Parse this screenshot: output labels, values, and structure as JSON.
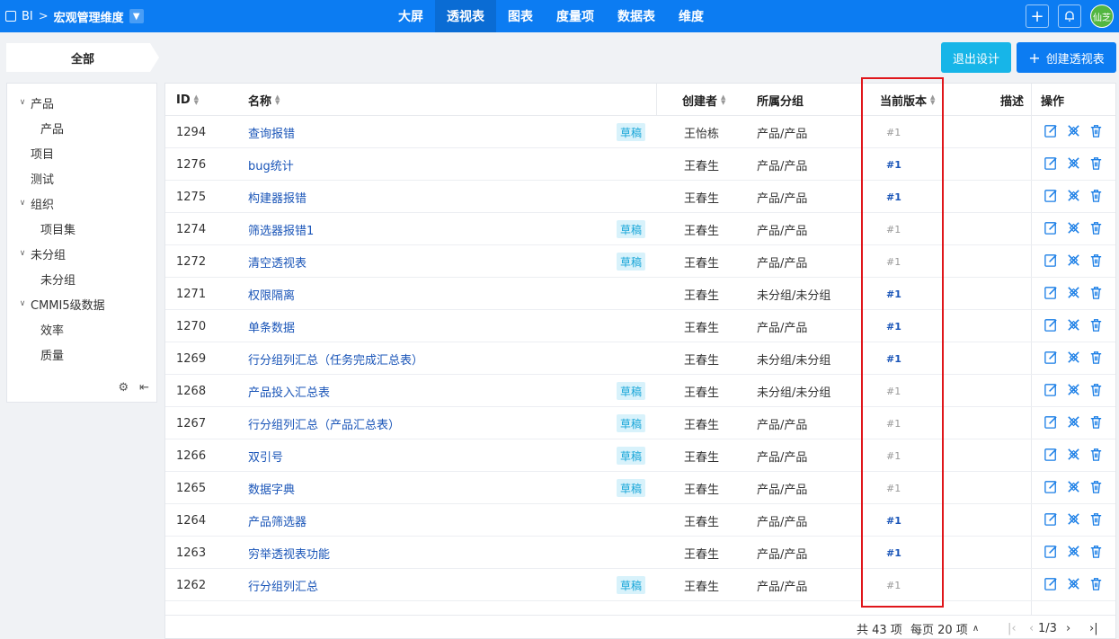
{
  "topbar": {
    "sep": ">",
    "app": "BI",
    "title": "宏观管理维度",
    "nav": [
      "大屏",
      "透视表",
      "图表",
      "度量项",
      "数据表",
      "维度"
    ],
    "active_nav": 1,
    "avatar": "仙芝"
  },
  "group_tab": "全部",
  "buttons": {
    "exit": "退出设计",
    "create": "创建透视表"
  },
  "tree": [
    {
      "label": "产品",
      "level": 0,
      "expanded": true
    },
    {
      "label": "产品",
      "level": 1
    },
    {
      "label": "项目",
      "level": 0
    },
    {
      "label": "测试",
      "level": 0
    },
    {
      "label": "组织",
      "level": 0,
      "expanded": true
    },
    {
      "label": "项目集",
      "level": 1
    },
    {
      "label": "未分组",
      "level": 0,
      "expanded": true
    },
    {
      "label": "未分组",
      "level": 1
    },
    {
      "label": "CMMI5级数据",
      "level": 0,
      "expanded": true
    },
    {
      "label": "效率",
      "level": 1
    },
    {
      "label": "质量",
      "level": 1
    }
  ],
  "table": {
    "headers": {
      "id": "ID",
      "name": "名称",
      "creator": "创建者",
      "group": "所属分组",
      "version": "当前版本",
      "desc": "描述",
      "ops": "操作"
    },
    "draft_label": "草稿",
    "rows": [
      {
        "id": "1294",
        "name": "查询报错",
        "draft": true,
        "creator": "王怡栋",
        "group": "产品/产品",
        "version": "#1",
        "published": false
      },
      {
        "id": "1276",
        "name": "bug统计",
        "draft": false,
        "creator": "王春生",
        "group": "产品/产品",
        "version": "#1",
        "published": true
      },
      {
        "id": "1275",
        "name": "构建器报错",
        "draft": false,
        "creator": "王春生",
        "group": "产品/产品",
        "version": "#1",
        "published": true
      },
      {
        "id": "1274",
        "name": "筛选器报错1",
        "draft": true,
        "creator": "王春生",
        "group": "产品/产品",
        "version": "#1",
        "published": false
      },
      {
        "id": "1272",
        "name": "清空透视表",
        "draft": true,
        "creator": "王春生",
        "group": "产品/产品",
        "version": "#1",
        "published": false
      },
      {
        "id": "1271",
        "name": "权限隔离",
        "draft": false,
        "creator": "王春生",
        "group": "未分组/未分组",
        "version": "#1",
        "published": true
      },
      {
        "id": "1270",
        "name": "单条数据",
        "draft": false,
        "creator": "王春生",
        "group": "产品/产品",
        "version": "#1",
        "published": true
      },
      {
        "id": "1269",
        "name": "行分组列汇总（任务完成汇总表）",
        "draft": false,
        "creator": "王春生",
        "group": "未分组/未分组",
        "version": "#1",
        "published": true
      },
      {
        "id": "1268",
        "name": "产品投入汇总表",
        "draft": true,
        "creator": "王春生",
        "group": "未分组/未分组",
        "version": "#1",
        "published": false
      },
      {
        "id": "1267",
        "name": "行分组列汇总（产品汇总表）",
        "draft": true,
        "creator": "王春生",
        "group": "产品/产品",
        "version": "#1",
        "published": false
      },
      {
        "id": "1266",
        "name": "双引号",
        "draft": true,
        "creator": "王春生",
        "group": "产品/产品",
        "version": "#1",
        "published": false
      },
      {
        "id": "1265",
        "name": "数据字典",
        "draft": true,
        "creator": "王春生",
        "group": "产品/产品",
        "version": "#1",
        "published": false
      },
      {
        "id": "1264",
        "name": "产品筛选器",
        "draft": false,
        "creator": "王春生",
        "group": "产品/产品",
        "version": "#1",
        "published": true
      },
      {
        "id": "1263",
        "name": "穷举透视表功能",
        "draft": false,
        "creator": "王春生",
        "group": "产品/产品",
        "version": "#1",
        "published": true
      },
      {
        "id": "1262",
        "name": "行分组列汇总",
        "draft": true,
        "creator": "王春生",
        "group": "产品/产品",
        "version": "#1",
        "published": false
      }
    ]
  },
  "pager": {
    "total": "共 43 项",
    "per_page": "每页 20 项",
    "page": "1/3"
  },
  "colors": {
    "primary": "#0c7cf2",
    "accent": "#17b5e8",
    "link": "#1a55b8",
    "highlight": "#e0161b"
  }
}
